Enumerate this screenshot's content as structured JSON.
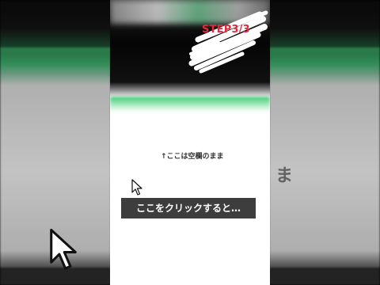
{
  "step": {
    "label": "STEP3/3",
    "color": "#e8263a"
  },
  "note": {
    "text": "↑ここは空欄のまま"
  },
  "caption": {
    "text": "ここをクリックすると…",
    "background": "#3d3d3d"
  },
  "icons": {
    "pointer": "arrow-cursor-icon",
    "scribble": "scribble-highlight-icon"
  }
}
